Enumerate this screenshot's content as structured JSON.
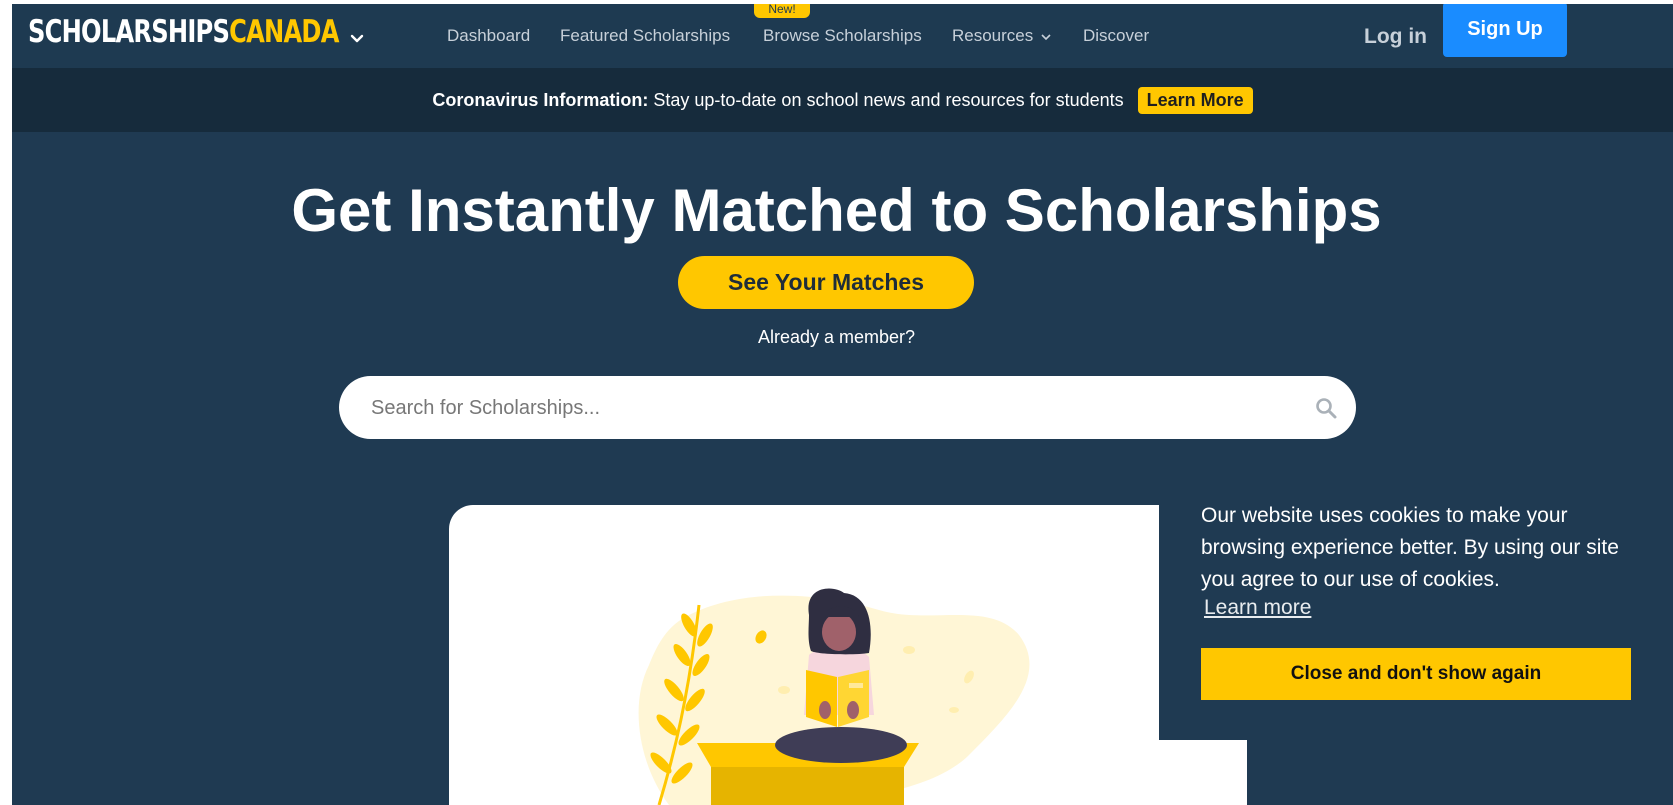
{
  "brand": {
    "name_part1": "SCHOLARSHIPS",
    "name_part2": "CANADA",
    "accent": "#ffc700",
    "navy": "#1f3a52"
  },
  "nav": {
    "links": [
      {
        "label": "Dashboard"
      },
      {
        "label": "Featured Scholarships"
      },
      {
        "label": "Browse Scholarships",
        "badge": "New!"
      },
      {
        "label": "Resources"
      },
      {
        "label": "Discover"
      }
    ],
    "login_label": "Log in",
    "signup_label": "Sign Up"
  },
  "announcement": {
    "heading": "Coronavirus Information:",
    "text": "Stay up-to-date on school news and resources for students",
    "button_label": "Learn More"
  },
  "hero": {
    "title": "Get Instantly Matched to Scholarships",
    "cta_label": "See Your Matches",
    "member_text": "Already a member?"
  },
  "search": {
    "placeholder": "Search for Scholarships...",
    "icon": "search-icon"
  },
  "cookie": {
    "message": "Our website uses cookies to make your browsing experience better. By using our site you agree to our use of cookies.",
    "link_label": "Learn more",
    "button_label": "Close and don't show again"
  }
}
